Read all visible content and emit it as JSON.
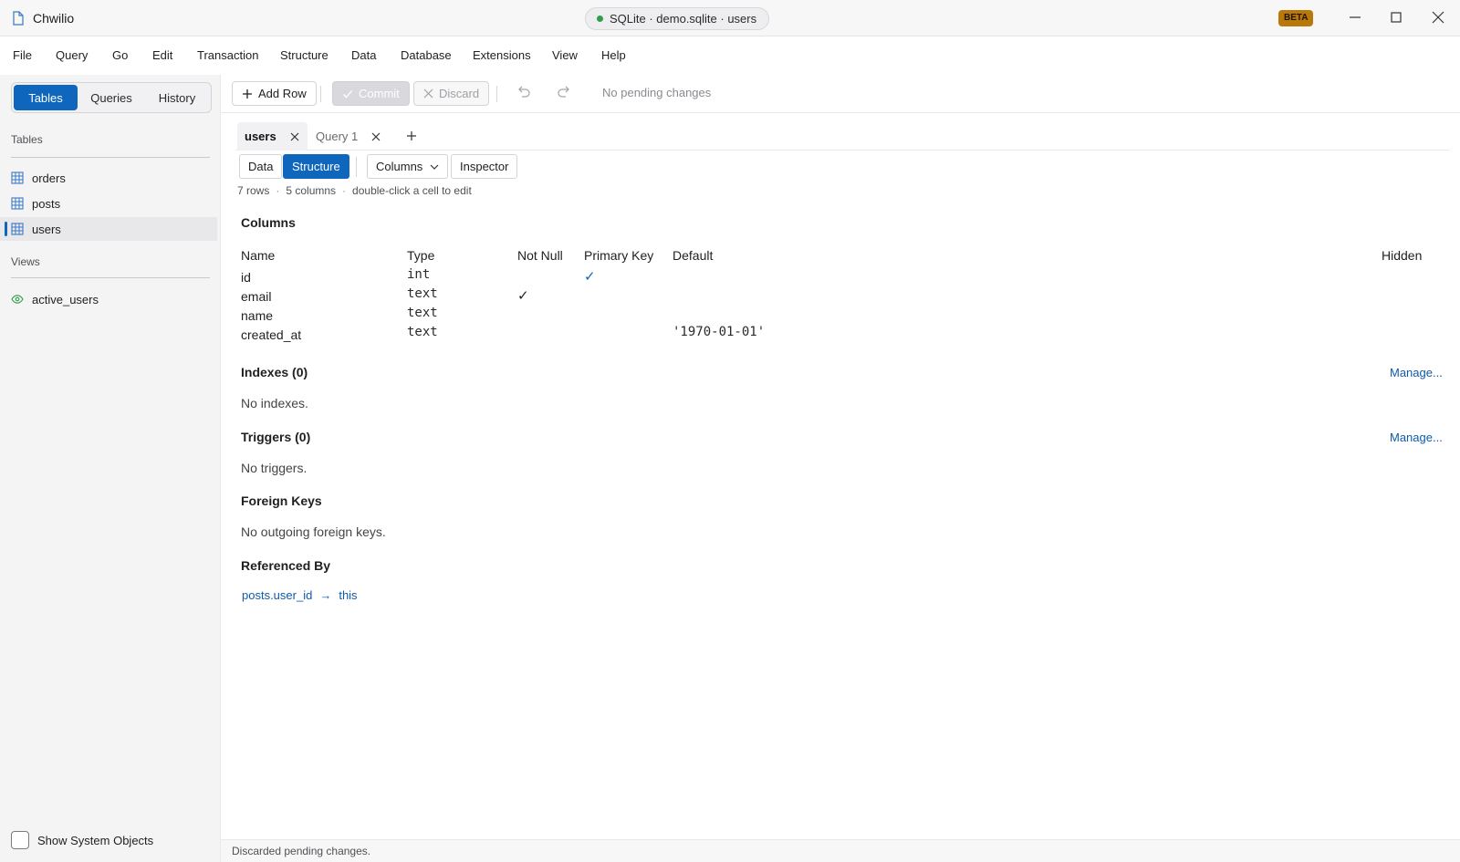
{
  "app": {
    "title": "Chwilio",
    "badge": "BETA"
  },
  "connection": {
    "label": "SQLite · demo.sqlite · users",
    "status_color": "#2e9e4a"
  },
  "menu": [
    "File",
    "Query",
    "Go",
    "Edit",
    "Transaction",
    "Structure",
    "Data",
    "Database",
    "Extensions",
    "View",
    "Help"
  ],
  "sidebar": {
    "tabs": [
      "Tables",
      "Queries",
      "History"
    ],
    "active_tab": "Tables",
    "tables_heading": "Tables",
    "tables": [
      "orders",
      "posts",
      "users"
    ],
    "selected_table": "users",
    "views_heading": "Views",
    "views": [
      "active_users"
    ],
    "show_system_objects": {
      "label": "Show System Objects",
      "checked": false
    }
  },
  "toolbar": {
    "add_row": "Add Row",
    "commit": "Commit",
    "discard": "Discard",
    "status": "No pending changes"
  },
  "tabs": [
    {
      "label": "users",
      "active": true
    },
    {
      "label": "Query 1",
      "active": false
    }
  ],
  "view_switch": {
    "data": "Data",
    "structure": "Structure",
    "active": "Structure",
    "columns": "Columns",
    "inspector": "Inspector"
  },
  "meta": {
    "rows": "7 rows",
    "columns": "5 columns",
    "hint": "double-click a cell to edit"
  },
  "structure": {
    "columns_title": "Columns",
    "headers": {
      "name": "Name",
      "type": "Type",
      "not_null": "Not Null",
      "primary_key": "Primary Key",
      "default": "Default",
      "hidden": "Hidden"
    },
    "rows": [
      {
        "name": "id",
        "type": "int",
        "not_null": false,
        "primary_key": true,
        "default": ""
      },
      {
        "name": "email",
        "type": "text",
        "not_null": true,
        "primary_key": false,
        "default": ""
      },
      {
        "name": "name",
        "type": "text",
        "not_null": false,
        "primary_key": false,
        "default": ""
      },
      {
        "name": "created_at",
        "type": "text",
        "not_null": false,
        "primary_key": false,
        "default": "'1970-01-01'"
      }
    ],
    "check_mark": "✓",
    "indexes_title": "Indexes (0)",
    "indexes_empty": "No indexes.",
    "triggers_title": "Triggers (0)",
    "triggers_empty": "No triggers.",
    "manage": "Manage...",
    "fk_title": "Foreign Keys",
    "fk_empty": "No outgoing foreign keys.",
    "ref_title": "Referenced By",
    "ref_source": "posts.user_id",
    "ref_arrow": "→",
    "ref_target": "this"
  },
  "statusbar": {
    "text": "Discarded pending changes."
  },
  "colors": {
    "accent": "#0f66bd",
    "badge": "#b9790a",
    "link": "#0f5aa8"
  }
}
